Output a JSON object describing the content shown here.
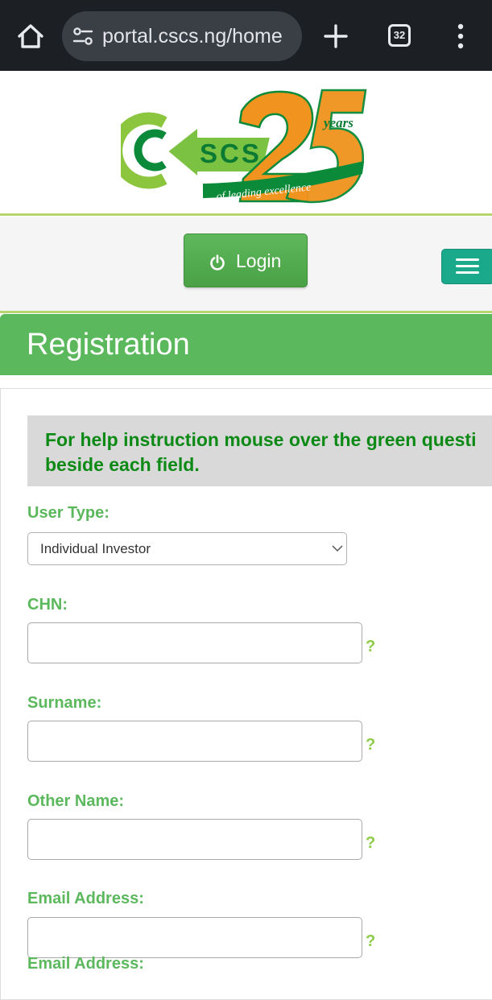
{
  "browser": {
    "url": "portal.cscs.ng/home",
    "tab_count": "32"
  },
  "logo": {
    "letters": "SCS",
    "years_number": "25",
    "years_word": "years",
    "tagline": "of leading excellence"
  },
  "nav": {
    "login_label": "Login"
  },
  "registration": {
    "title": "Registration",
    "help_text": "For help instruction mouse over the green question mark beside each field.",
    "help_line1": "For help instruction mouse over the green questi",
    "help_line2": "beside each field.",
    "help_marker": "?",
    "fields": {
      "user_type": {
        "label": "User Type:",
        "selected": "Individual Investor"
      },
      "chn": {
        "label": "CHN:"
      },
      "surname": {
        "label": "Surname:"
      },
      "other_name": {
        "label": "Other Name:"
      },
      "email": {
        "label": "Email Address:"
      },
      "email_confirm": {
        "label": "Email Address:"
      }
    }
  },
  "colors": {
    "brand_green": "#5cb85c",
    "help_text_green": "#0d8a16",
    "menu_teal": "#1aa98a",
    "logo_orange": "#f0941f"
  }
}
